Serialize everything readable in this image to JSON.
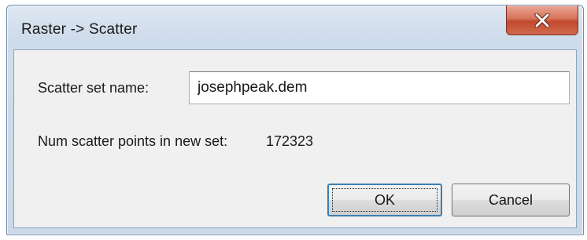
{
  "window": {
    "title": "Raster -> Scatter",
    "close_icon": "close-icon"
  },
  "form": {
    "name_label": "Scatter set name:",
    "name_value": "josephpeak.dem",
    "count_label": "Num scatter points in new set:",
    "count_value": "172323"
  },
  "buttons": {
    "ok_label": "OK",
    "cancel_label": "Cancel"
  },
  "colors": {
    "close_button": "#c24a2e",
    "titlebar": "#dfe8f3",
    "ok_border": "#3c7fb1"
  }
}
